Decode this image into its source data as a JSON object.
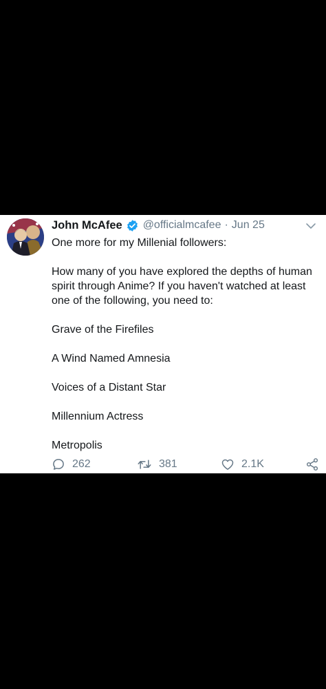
{
  "tweet": {
    "author": {
      "display_name": "John McAfee",
      "handle": "@officialmcafee",
      "verified": true,
      "avatar_icon": "avatar"
    },
    "separator": "·",
    "date": "Jun 25",
    "menu_icon": "chevron-down-icon",
    "lines": [
      "One more for my Millenial followers:",
      "",
      "How many of you have explored the depths of human spirit through Anime? If you haven't watched at least one of the following, you need to:",
      "",
      "Grave of the Firefiles",
      "",
      "A Wind Named Amnesia",
      "",
      "Voices of a Distant Star",
      "",
      "Millennium Actress",
      "",
      "Metropolis"
    ],
    "actions": {
      "replies": "262",
      "retweets": "381",
      "likes": "2.1K",
      "share_icon": "share-icon"
    },
    "colors": {
      "verified_blue": "#1da1f2",
      "muted_gray": "#657786",
      "text": "#14171a",
      "background": "#ffffff",
      "outer_background": "#000000"
    }
  }
}
